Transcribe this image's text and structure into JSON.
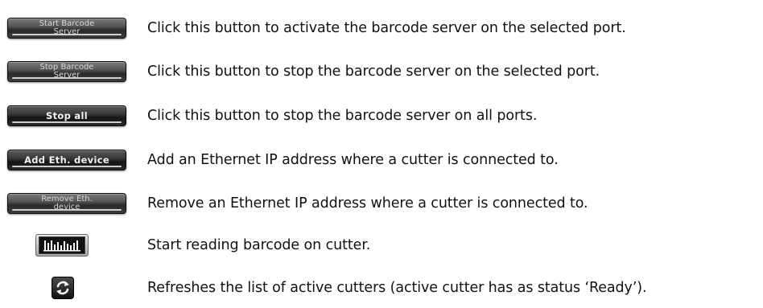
{
  "rows": [
    {
      "button_lines": [
        "Start Barcode",
        "Server"
      ],
      "description": "Click this button to activate the barcode server on the selected port."
    },
    {
      "button_lines": [
        "Stop Barcode",
        "Server"
      ],
      "description": "Click this button to stop the barcode server on the selected port."
    },
    {
      "button_lines": [
        "Stop all"
      ],
      "description": "Click this button to stop the barcode server on all ports."
    },
    {
      "button_lines": [
        "Add Eth. device"
      ],
      "description": "Add an Ethernet IP address where a cutter is connected to."
    },
    {
      "button_lines": [
        "Remove Eth.",
        "device"
      ],
      "description": "Remove an Ethernet IP address where a cutter is connected to."
    },
    {
      "icon": "barcode-icon",
      "description": "Start reading barcode on cutter."
    },
    {
      "icon": "refresh-icon",
      "description": "Refreshes the list of active cutters (active cutter has as status ‘Ready’)."
    }
  ]
}
